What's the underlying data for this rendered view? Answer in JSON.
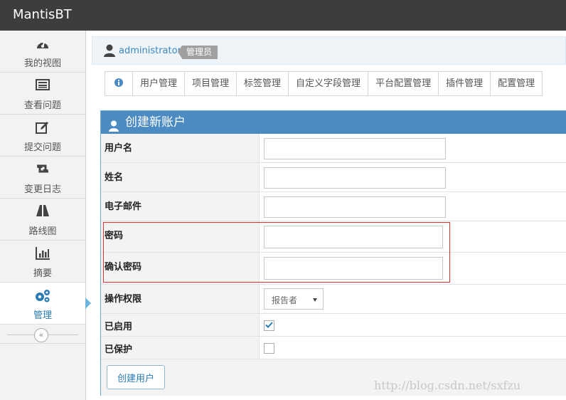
{
  "app": {
    "title": "MantisBT"
  },
  "sidebar": {
    "items": [
      {
        "label": "我的视图",
        "icon": "dashboard-icon"
      },
      {
        "label": "查看问题",
        "icon": "list-icon"
      },
      {
        "label": "提交问题",
        "icon": "edit-icon"
      },
      {
        "label": "变更日志",
        "icon": "retweet-icon"
      },
      {
        "label": "路线图",
        "icon": "road-icon"
      },
      {
        "label": "摘要",
        "icon": "bar-chart-icon"
      },
      {
        "label": "管理",
        "icon": "gears-icon",
        "active": true
      }
    ],
    "collapse_glyph": "«"
  },
  "breadcrumb": {
    "username": "administrator",
    "role_badge": "管理员"
  },
  "tabs": [
    {
      "label": "",
      "icon": "info-icon"
    },
    {
      "label": "用户管理"
    },
    {
      "label": "项目管理"
    },
    {
      "label": "标签管理"
    },
    {
      "label": "自定义字段管理"
    },
    {
      "label": "平台配置管理"
    },
    {
      "label": "插件管理"
    },
    {
      "label": "配置管理"
    }
  ],
  "form": {
    "title": "创建新账户",
    "fields": {
      "username": {
        "label": "用户名",
        "value": ""
      },
      "realname": {
        "label": "姓名",
        "value": ""
      },
      "email": {
        "label": "电子邮件",
        "value": ""
      },
      "password": {
        "label": "密码",
        "value": ""
      },
      "password_confirm": {
        "label": "确认密码",
        "value": ""
      },
      "access_level": {
        "label": "操作权限",
        "value": "报告者"
      },
      "enabled": {
        "label": "已启用",
        "checked": true
      },
      "protected": {
        "label": "已保护",
        "checked": false
      }
    },
    "submit_label": "创建用户"
  },
  "watermark": "http://blog.csdn.net/sxfzu",
  "colors": {
    "topbar": "#3d3d3d",
    "accent": "#4b8bc2",
    "highlight": "#e03030"
  }
}
